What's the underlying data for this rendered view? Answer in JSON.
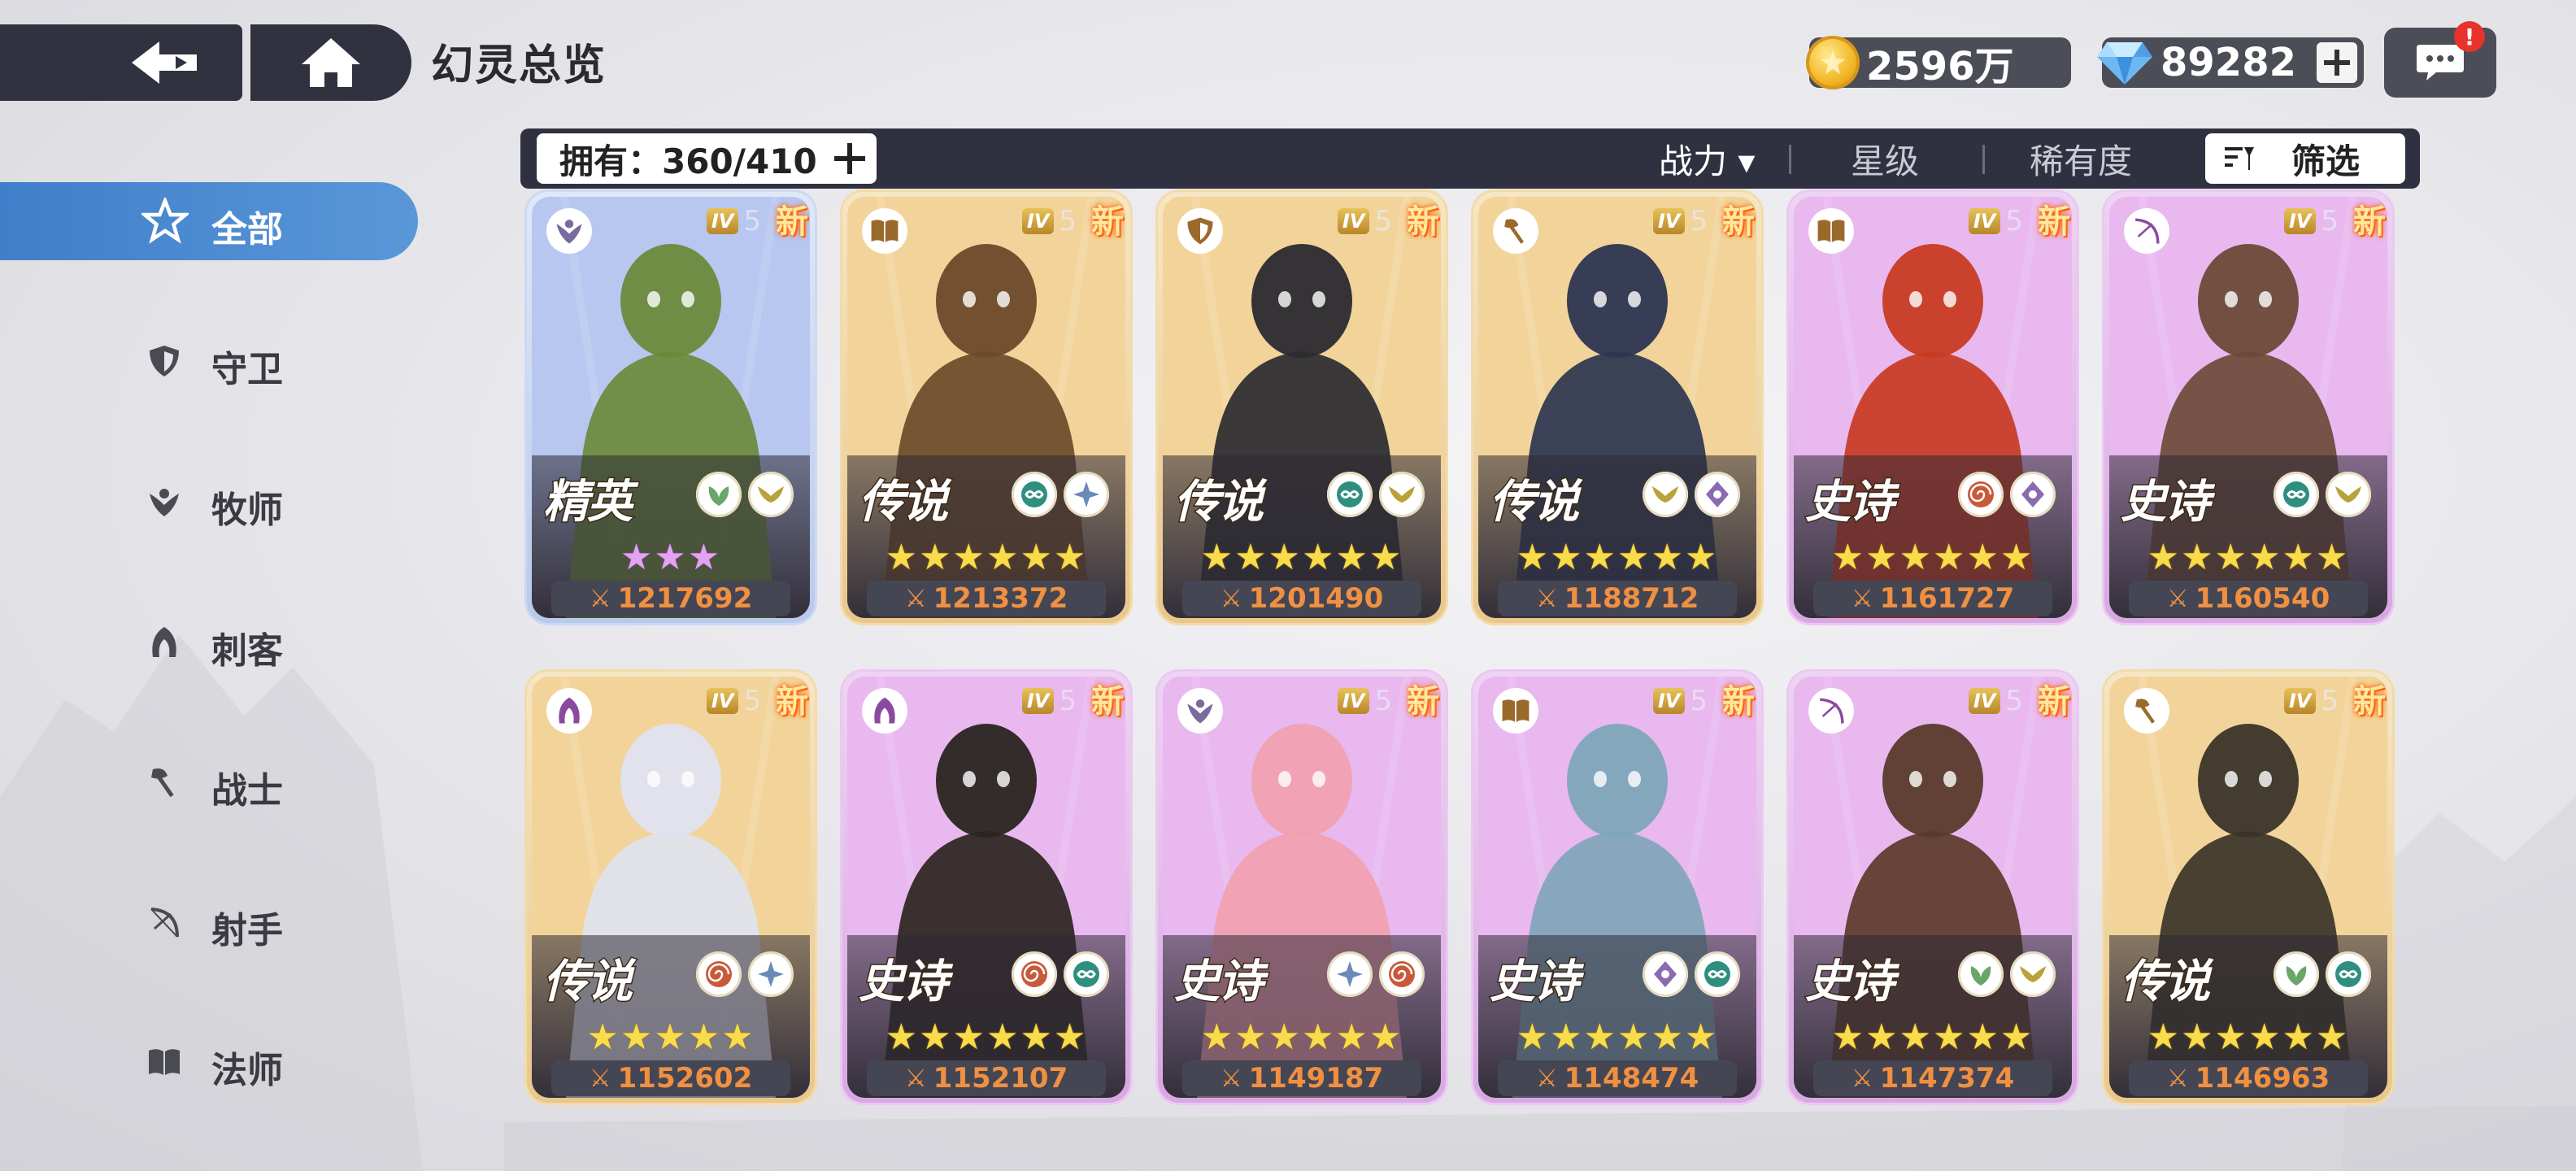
{
  "header": {
    "title": "幻灵总览"
  },
  "currency": {
    "gold": "2596万",
    "gems": "89282"
  },
  "notifications": {
    "badge": "!"
  },
  "sidebar": {
    "items": [
      {
        "label": "全部",
        "icon": "all-star-icon",
        "active": true
      },
      {
        "label": "守卫",
        "icon": "shield-icon"
      },
      {
        "label": "牧师",
        "icon": "priest-icon"
      },
      {
        "label": "刺客",
        "icon": "assassin-icon"
      },
      {
        "label": "战士",
        "icon": "axe-icon"
      },
      {
        "label": "射手",
        "icon": "bow-icon"
      },
      {
        "label": "法师",
        "icon": "book-icon"
      }
    ]
  },
  "toolbar": {
    "owned_label": "拥有：360/410",
    "sort_power": "战力 ▾",
    "sort_star": "星级",
    "sort_rarity": "稀有度",
    "filter_label": "筛选"
  },
  "cards": [
    {
      "rarity": "精英",
      "tier": "elite",
      "role_icon": "priest-icon",
      "level_tag": "IV",
      "level": "5",
      "new": "新",
      "stars": "★★★",
      "power": "1217692",
      "badges": [
        "leaf-badge-icon",
        "wing-badge-icon"
      ],
      "palette": [
        "#b7c7f0",
        "#6a8a3a"
      ]
    },
    {
      "rarity": "传说",
      "tier": "legend",
      "role_icon": "book-icon",
      "level_tag": "IV",
      "level": "5",
      "new": "新",
      "stars": "★★★★★★",
      "power": "1213372",
      "badges": [
        "infinity-badge-icon",
        "sparkle-badge-icon"
      ],
      "palette": [
        "#f2d49a",
        "#6b4a2a"
      ]
    },
    {
      "rarity": "传说",
      "tier": "legend",
      "role_icon": "shield-icon",
      "level_tag": "IV",
      "level": "5",
      "new": "新",
      "stars": "★★★★★★",
      "power": "1201490",
      "badges": [
        "infinity-badge-icon",
        "wing-badge-icon"
      ],
      "palette": [
        "#f2d49a",
        "#2a2a30"
      ]
    },
    {
      "rarity": "传说",
      "tier": "legend",
      "role_icon": "axe-icon",
      "level_tag": "IV",
      "level": "5",
      "new": "新",
      "stars": "★★★★★★",
      "power": "1188712",
      "badges": [
        "wing-badge-icon",
        "diamond-badge-icon"
      ],
      "palette": [
        "#f2d49a",
        "#2c3550"
      ]
    },
    {
      "rarity": "史诗",
      "tier": "epic",
      "role_icon": "book-icon",
      "level_tag": "IV",
      "level": "5",
      "new": "新",
      "stars": "★★★★★★",
      "power": "1161727",
      "badges": [
        "spiral-badge-icon",
        "diamond-badge-icon"
      ],
      "palette": [
        "#e8b8ef",
        "#c83a22"
      ]
    },
    {
      "rarity": "史诗",
      "tier": "epic",
      "role_icon": "bow-icon",
      "level_tag": "IV",
      "level": "5",
      "new": "新",
      "stars": "★★★★★★",
      "power": "1160540",
      "badges": [
        "infinity-badge-icon",
        "wing-badge-icon"
      ],
      "palette": [
        "#e8b8ef",
        "#6a4a38"
      ]
    },
    {
      "rarity": "传说",
      "tier": "legend",
      "role_icon": "assassin-icon",
      "level_tag": "IV",
      "level": "5",
      "new": "新",
      "stars": "★★★★★",
      "power": "1152602",
      "badges": [
        "spiral-badge-icon",
        "sparkle-badge-icon"
      ],
      "palette": [
        "#f2d49a",
        "#dfe3ef"
      ]
    },
    {
      "rarity": "史诗",
      "tier": "epic",
      "role_icon": "assassin-icon",
      "level_tag": "IV",
      "level": "5",
      "new": "新",
      "stars": "★★★★★★",
      "power": "1152107",
      "badges": [
        "spiral-badge-icon",
        "infinity-badge-icon"
      ],
      "palette": [
        "#e8b8ef",
        "#2a2420"
      ]
    },
    {
      "rarity": "史诗",
      "tier": "epic",
      "role_icon": "priest-icon",
      "level_tag": "IV",
      "level": "5",
      "new": "新",
      "stars": "★★★★★★",
      "power": "1149187",
      "badges": [
        "sparkle-badge-icon",
        "spiral-badge-icon"
      ],
      "palette": [
        "#e8b8ef",
        "#f1a0b0"
      ]
    },
    {
      "rarity": "史诗",
      "tier": "epic",
      "role_icon": "book-icon",
      "level_tag": "IV",
      "level": "5",
      "new": "新",
      "stars": "★★★★★★",
      "power": "1148474",
      "badges": [
        "diamond-badge-icon",
        "infinity-badge-icon"
      ],
      "palette": [
        "#e8b8ef",
        "#7fa5b8"
      ]
    },
    {
      "rarity": "史诗",
      "tier": "epic",
      "role_icon": "bow-icon",
      "level_tag": "IV",
      "level": "5",
      "new": "新",
      "stars": "★★★★★★",
      "power": "1147374",
      "badges": [
        "leaf-badge-icon",
        "wing-badge-icon"
      ],
      "palette": [
        "#e8b8ef",
        "#5a3a2a"
      ]
    },
    {
      "rarity": "传说",
      "tier": "legend",
      "role_icon": "axe-icon",
      "level_tag": "IV",
      "level": "5",
      "new": "新",
      "stars": "★★★★★★",
      "power": "1146963",
      "badges": [
        "leaf-badge-icon",
        "infinity-badge-icon"
      ],
      "palette": [
        "#f2d49a",
        "#3a3428"
      ]
    }
  ]
}
